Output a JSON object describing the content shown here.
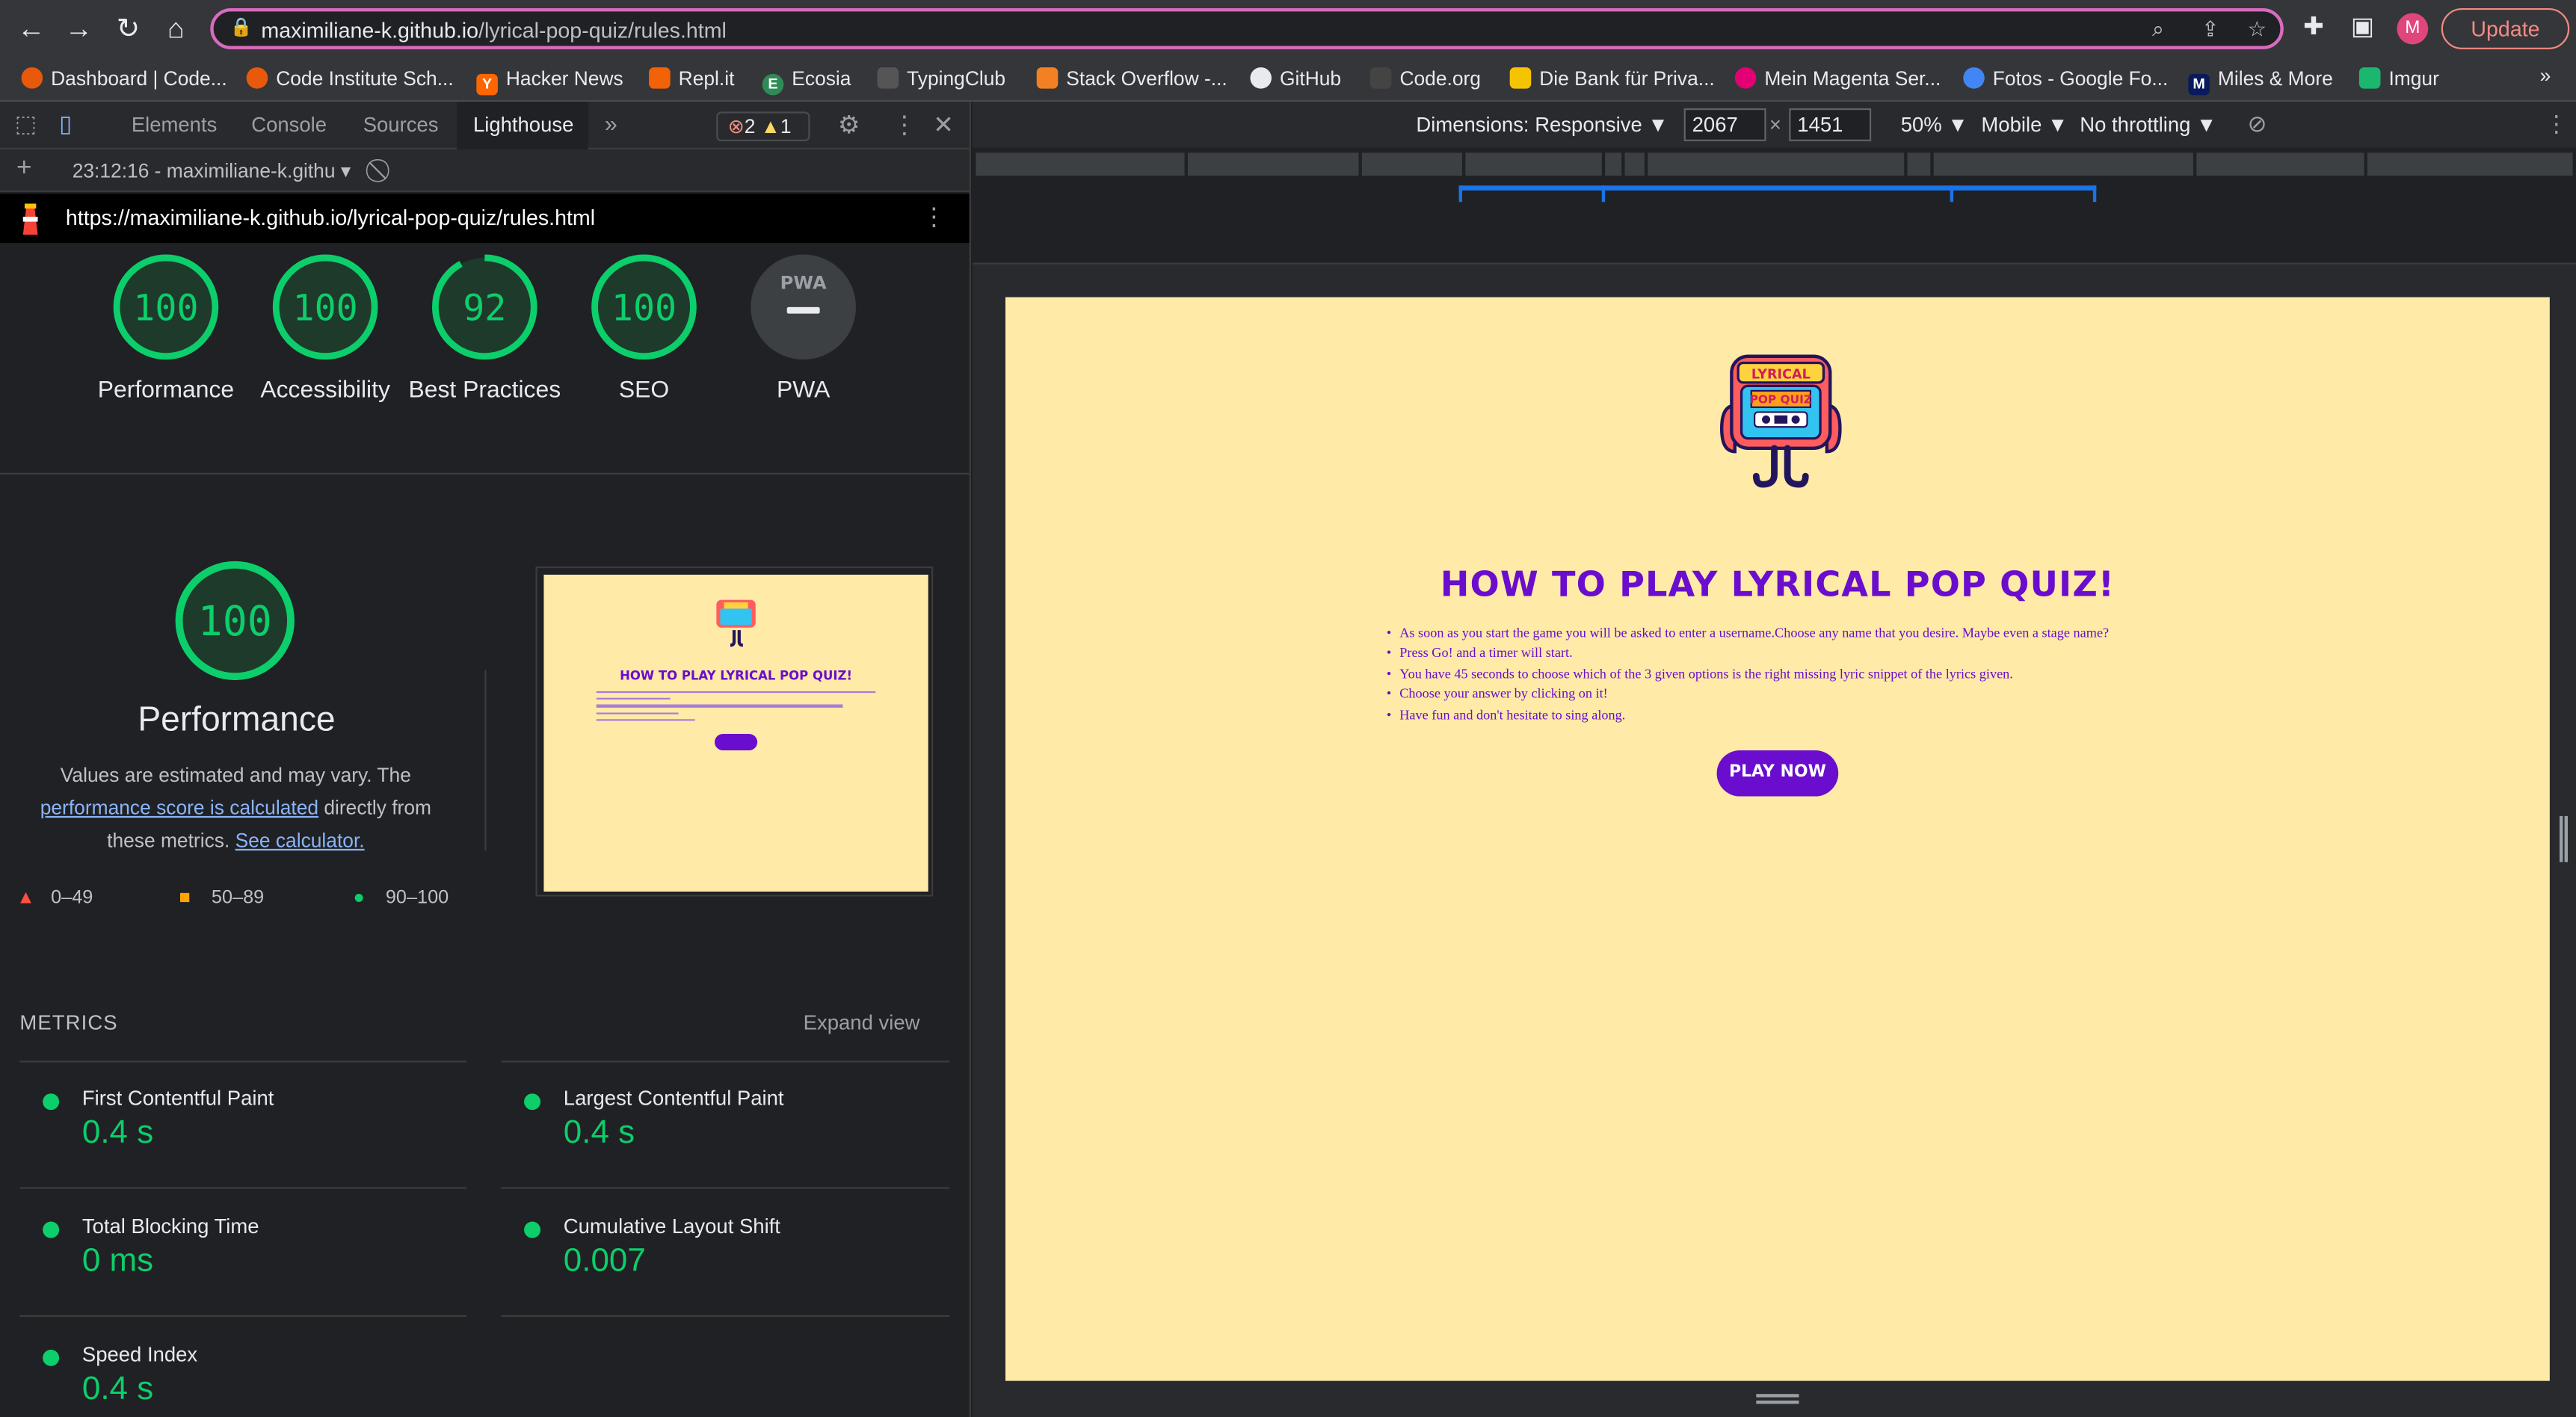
{
  "browser": {
    "url_host": "maximiliane-k.github.io",
    "url_path": "/lyrical-pop-quiz/rules.html",
    "avatar_letter": "M",
    "update_label": "Update"
  },
  "bookmarks": [
    {
      "label": "Dashboard | Code...",
      "color": "#e8590c"
    },
    {
      "label": "Code Institute Sch...",
      "color": "#e8590c"
    },
    {
      "label": "Hacker News",
      "color": "#ff6600"
    },
    {
      "label": "Repl.it",
      "color": "#f26207"
    },
    {
      "label": "Ecosia",
      "color": "#2e8b57"
    },
    {
      "label": "TypingClub",
      "color": "#555555"
    },
    {
      "label": "Stack Overflow -...",
      "color": "#f48024"
    },
    {
      "label": "GitHub",
      "color": "#e8eaed"
    },
    {
      "label": "Code.org",
      "color": "#444444"
    },
    {
      "label": "Die Bank für Priva...",
      "color": "#f5c400"
    },
    {
      "label": "Mein Magenta Ser...",
      "color": "#e20074"
    },
    {
      "label": "Fotos - Google Fo...",
      "color": "#4285f4"
    },
    {
      "label": "Miles & More",
      "color": "#0a1a5c"
    },
    {
      "label": "Imgur",
      "color": "#1bb76e"
    }
  ],
  "bookmarks_more": "»",
  "devtools": {
    "tabs": [
      "Elements",
      "Console",
      "Sources",
      "Lighthouse"
    ],
    "more_tabs": "»",
    "errors": "2",
    "warnings": "1",
    "report_label": "23:12:16 - maximiliane-k.githu",
    "lighthouse_url": "https://maximiliane-k.github.io/lyrical-pop-quiz/rules.html"
  },
  "scores": [
    {
      "label": "Performance",
      "value": 100
    },
    {
      "label": "Accessibility",
      "value": 100
    },
    {
      "label": "Best Practices",
      "value": 92
    },
    {
      "label": "SEO",
      "value": 100
    },
    {
      "label": "PWA",
      "value": null
    }
  ],
  "pwa_badge": "PWA",
  "performance": {
    "score": 100,
    "title": "Performance",
    "desc_1": "Values are estimated and may vary. The ",
    "desc_link_1": "performance score is calculated",
    "desc_2": " directly from these metrics. ",
    "desc_link_2": "See calculator."
  },
  "legend": [
    "0–49",
    "50–89",
    "90–100"
  ],
  "metrics": {
    "title": "METRICS",
    "expand": "Expand view",
    "items": [
      {
        "name": "First Contentful Paint",
        "value": "0.4 s"
      },
      {
        "name": "Largest Contentful Paint",
        "value": "0.4 s"
      },
      {
        "name": "Total Blocking Time",
        "value": "0 ms"
      },
      {
        "name": "Cumulative Layout Shift",
        "value": "0.007"
      },
      {
        "name": "Speed Index",
        "value": "0.4 s"
      }
    ]
  },
  "device_toolbar": {
    "dimensions": "Dimensions: Responsive ▼",
    "width": "2067",
    "height": "1451",
    "zoom": "50% ▼",
    "device": "Mobile ▼",
    "throttling": "No throttling ▼"
  },
  "site": {
    "logo_line1": "LYRICAL",
    "logo_line2": "POP QUIZ",
    "title": "HOW TO PLAY LYRICAL POP QUIZ!",
    "rules": [
      "As soon as you start the game you will be asked to enter a username.Choose any name that you desire. Maybe even a stage name?",
      "Press Go! and a timer will start.",
      "You have 45 seconds to choose which of the 3 given options is the right missing lyric snippet of the lyrics given.",
      "Choose your answer by clicking on it!",
      "Have fun and don't hesitate to sing along."
    ],
    "play_label": "PLAY NOW"
  },
  "colors": {
    "pass": "#0cce6b",
    "site_bg": "#ffeaa7",
    "site_accent": "#6a0dce"
  }
}
